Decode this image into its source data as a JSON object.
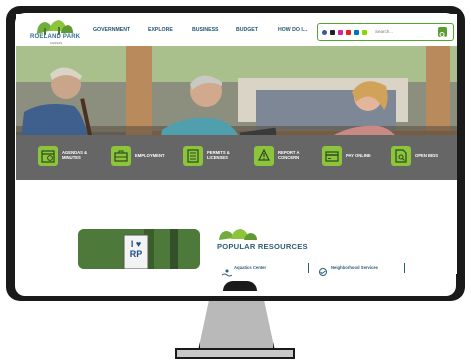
{
  "site": {
    "name": "ROELAND PARK",
    "tagline": "KANSAS"
  },
  "nav": {
    "items": [
      {
        "label": "GOVERNMENT"
      },
      {
        "label": "EXPLORE"
      },
      {
        "label": "BUSINESS"
      },
      {
        "label": "BUDGET"
      },
      {
        "label": "HOW DO I..."
      }
    ]
  },
  "search": {
    "placeholder": "Search..."
  },
  "social": [
    "facebook-icon",
    "x-icon",
    "instagram-icon",
    "youtube-icon",
    "linkedin-icon",
    "nextdoor-icon"
  ],
  "quick_links": [
    {
      "label_1": "AGENDAS &",
      "label_2": "MINUTES",
      "icon": "calendar-icon"
    },
    {
      "label_1": "EMPLOYMENT",
      "label_2": "",
      "icon": "briefcase-icon"
    },
    {
      "label_1": "PERMITS &",
      "label_2": "LICENSES",
      "icon": "document-list-icon"
    },
    {
      "label_1": "REPORT A",
      "label_2": "CONCERN",
      "icon": "alert-hand-icon"
    },
    {
      "label_1": "PAY ONLINE",
      "label_2": "",
      "icon": "credit-card-icon"
    },
    {
      "label_1": "OPEN BIDS",
      "label_2": "",
      "icon": "document-search-icon"
    }
  ],
  "popular": {
    "title": "POPULAR RESOURCES",
    "items": [
      {
        "label": "Aquatics Center",
        "icon": "pool-icon"
      },
      {
        "label": "Neighborhood Services",
        "icon": "handshake-icon"
      }
    ]
  },
  "photo": {
    "sign_text": "I ♥ RP"
  },
  "colors": {
    "brand_green": "#8cc43c",
    "brand_blue": "#2e5f78",
    "band_gray": "#666666"
  }
}
